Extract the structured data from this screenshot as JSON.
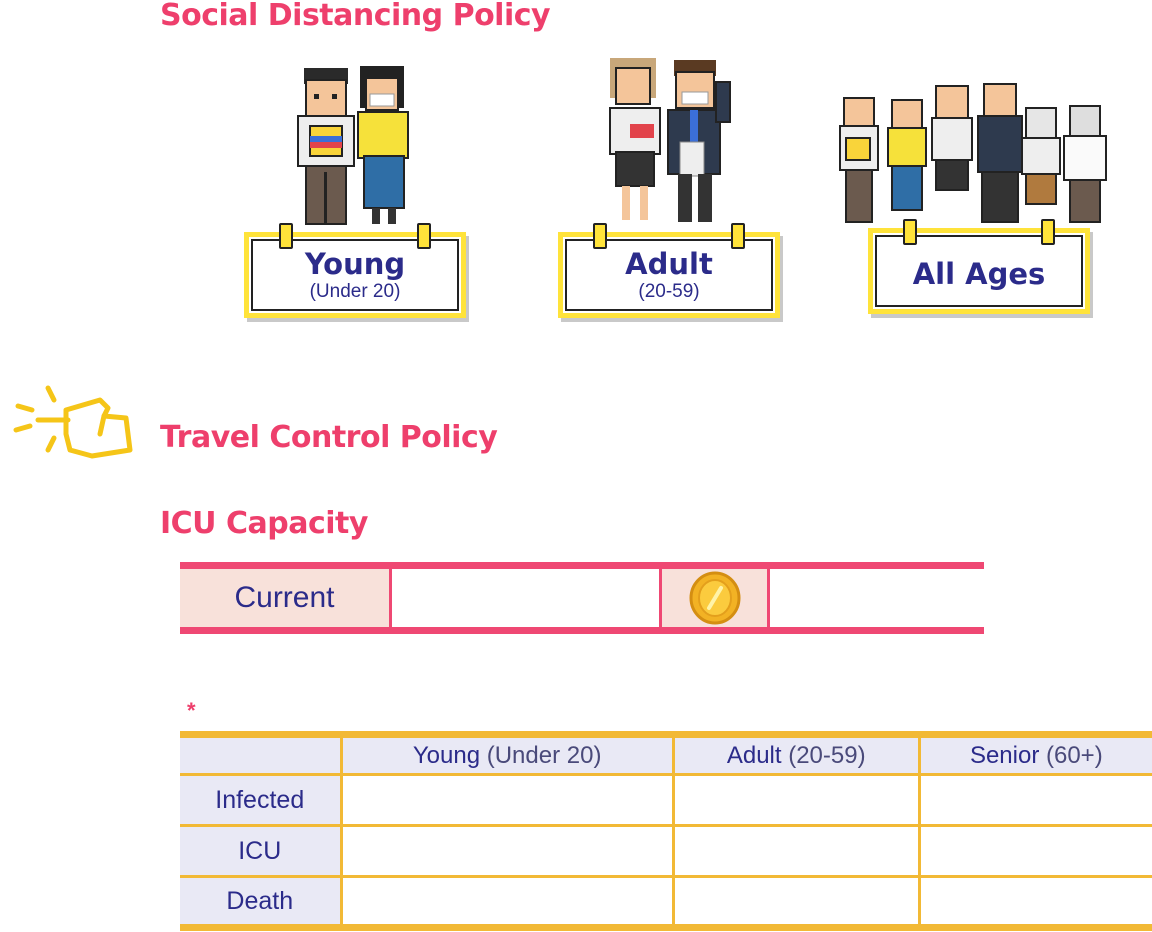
{
  "sections": {
    "social_distancing": "Social Distancing Policy",
    "travel_control": "Travel Control Policy",
    "icu_capacity": "ICU Capacity"
  },
  "age_groups": [
    {
      "label": "Young",
      "range": "(Under 20)"
    },
    {
      "label": "Adult",
      "range": "(20-59)"
    },
    {
      "label": "All Ages",
      "range": ""
    }
  ],
  "capacity_bar": {
    "label": "Current",
    "current_value": "",
    "coin_icon": "coin-icon",
    "coin_value": ""
  },
  "footnote_marker": "*",
  "table": {
    "columns": [
      {
        "label": "Young",
        "range": "(Under 20)"
      },
      {
        "label": "Adult",
        "range": "(20-59)"
      },
      {
        "label": "Senior",
        "range": "(60+)"
      }
    ],
    "rows": [
      {
        "label": "Infected",
        "values": [
          "",
          "",
          ""
        ]
      },
      {
        "label": "ICU",
        "values": [
          "",
          "",
          ""
        ]
      },
      {
        "label": "Death",
        "values": [
          "",
          "",
          ""
        ]
      }
    ]
  },
  "colors": {
    "accent": "#ee3f6c",
    "text_navy": "#2b2b8a",
    "sign_yellow": "#ffe33a",
    "table_border": "#f2b935"
  }
}
